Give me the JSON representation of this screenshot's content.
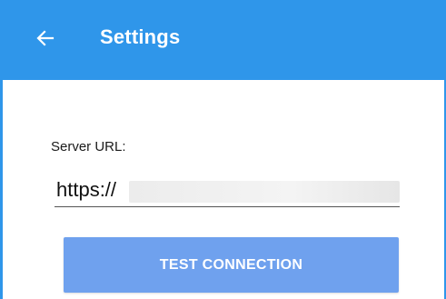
{
  "app_bar": {
    "title": "Settings",
    "back_icon": "arrow-left-icon",
    "background_color": "#2f96ea"
  },
  "server_url": {
    "label": "Server URL:",
    "value": "https://"
  },
  "actions": {
    "test_connection_label": "TEST CONNECTION",
    "button_color": "#6fa1ee"
  }
}
